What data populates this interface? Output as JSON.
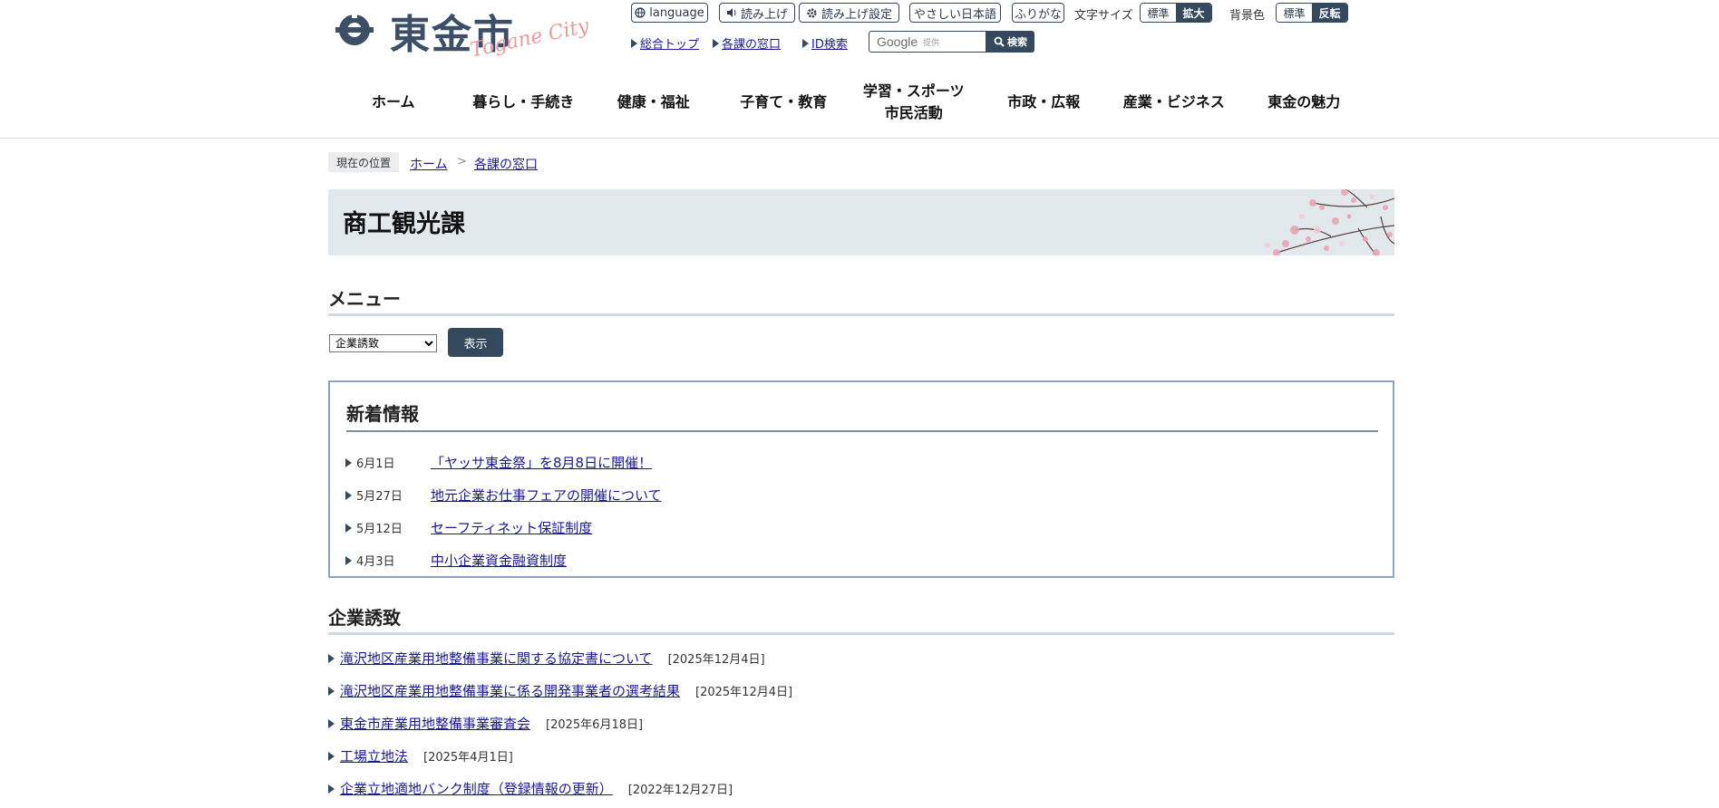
{
  "header": {
    "logo_text": "東金市",
    "logo_sub": "Togane City",
    "toolbar": {
      "language": "language",
      "read_aloud": "読み上げ",
      "read_settings": "読み上げ設定",
      "easy_japanese": "やさしい日本語",
      "furigana": "ふりがな",
      "font_size_label": "文字サイズ",
      "font_standard": "標準",
      "font_large": "拡大",
      "bg_label": "背景色",
      "bg_standard": "標準",
      "bg_invert": "反転"
    },
    "quick_links": [
      "総合トップ",
      "各課の窓口",
      "ID検索"
    ],
    "search": {
      "brand": "Google",
      "provided": "提供",
      "button": "検索"
    }
  },
  "nav": {
    "items": [
      "ホーム",
      "暮らし・手続き",
      "健康・福祉",
      "子育て・教育",
      "学習・スポーツ",
      "市民活動",
      "市政・広報",
      "産業・ビジネス",
      "東金の魅力"
    ]
  },
  "breadcrumb": {
    "label": "現在の位置",
    "items": [
      "ホーム",
      "各課の窓口"
    ],
    "separator": ">"
  },
  "page": {
    "title": "商工観光課"
  },
  "menu": {
    "heading": "メニュー",
    "selected": "企業誘致",
    "show_button": "表示"
  },
  "news": {
    "heading": "新着情報",
    "items": [
      {
        "date": "6月1日",
        "title": "「ヤッサ東金祭」を8月8日に開催！"
      },
      {
        "date": "5月27日",
        "title": "地元企業お仕事フェアの開催について"
      },
      {
        "date": "5月12日",
        "title": "セーフティネット保証制度"
      },
      {
        "date": "4月3日",
        "title": "中小企業資金融資制度"
      }
    ]
  },
  "invest": {
    "heading": "企業誘致",
    "items": [
      {
        "title": "滝沢地区産業用地整備事業に関する協定書について",
        "date": "[2025年12月4日]"
      },
      {
        "title": "滝沢地区産業用地整備事業に係る開発事業者の選考結果",
        "date": "[2025年12月4日]"
      },
      {
        "title": "東金市産業用地整備事業審査会",
        "date": "[2025年6月18日]"
      },
      {
        "title": "工場立地法",
        "date": "[2025年4月1日]"
      },
      {
        "title": "企業立地適地バンク制度（登録情報の更新）",
        "date": "[2022年12月27日]"
      }
    ]
  },
  "colors": {
    "accent": "#34495e",
    "banner": "#e2e9ed",
    "link": "#1a1a8c",
    "blossom": "#e8a6b3"
  }
}
